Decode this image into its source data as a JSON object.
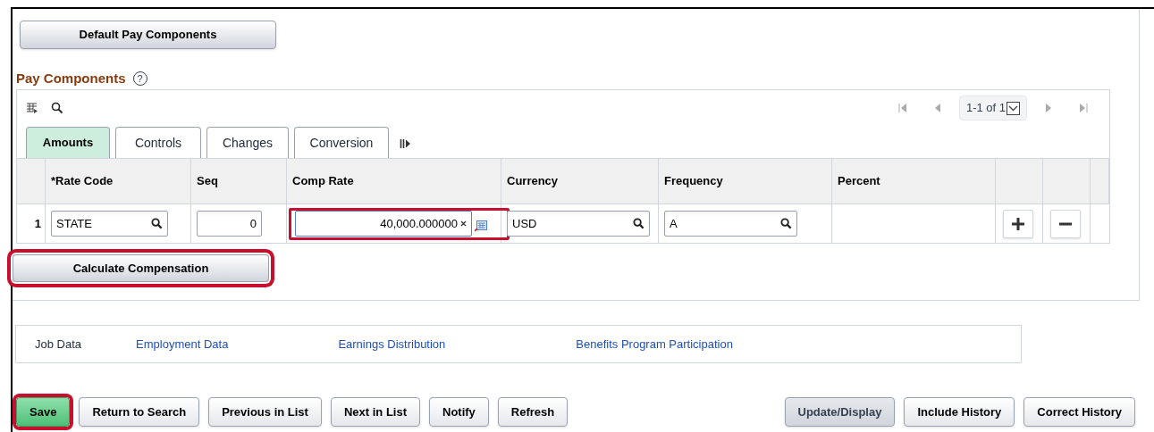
{
  "default_button": {
    "label": "Default Pay Components"
  },
  "section": {
    "title": "Pay Components",
    "help": "?"
  },
  "grid": {
    "pager": "1-1 of 1",
    "tabs": [
      {
        "label": "Amounts",
        "selected": true
      },
      {
        "label": "Controls",
        "selected": false
      },
      {
        "label": "Changes",
        "selected": false
      },
      {
        "label": "Conversion",
        "selected": false
      }
    ],
    "columns": [
      "*Rate Code",
      "Seq",
      "Comp Rate",
      "Currency",
      "Frequency",
      "Percent"
    ],
    "rows": [
      {
        "number": "1",
        "rate_code": "STATE",
        "seq": "0",
        "comp_rate": "40,000.000000",
        "comp_rate_highlighted": true,
        "currency": "USD",
        "frequency": "A"
      }
    ]
  },
  "calculate_button": {
    "label": "Calculate Compensation",
    "highlighted": true
  },
  "links": [
    {
      "label": "Job Data",
      "current": true
    },
    {
      "label": "Employment Data",
      "current": false
    },
    {
      "label": "Earnings Distribution",
      "current": false
    },
    {
      "label": "Benefits Program Participation",
      "current": false
    }
  ],
  "actions_left": [
    {
      "label": "Save",
      "kind": "primary",
      "highlighted": true
    },
    {
      "label": "Return to Search",
      "kind": "normal",
      "highlighted": false
    },
    {
      "label": "Previous in List",
      "kind": "normal",
      "highlighted": false
    },
    {
      "label": "Next in List",
      "kind": "normal",
      "highlighted": false
    },
    {
      "label": "Notify",
      "kind": "normal",
      "highlighted": false
    },
    {
      "label": "Refresh",
      "kind": "normal",
      "highlighted": false
    }
  ],
  "actions_right": [
    {
      "label": "Update/Display",
      "kind": "pressed"
    },
    {
      "label": "Include History",
      "kind": "normal"
    },
    {
      "label": "Correct History",
      "kind": "normal"
    }
  ]
}
